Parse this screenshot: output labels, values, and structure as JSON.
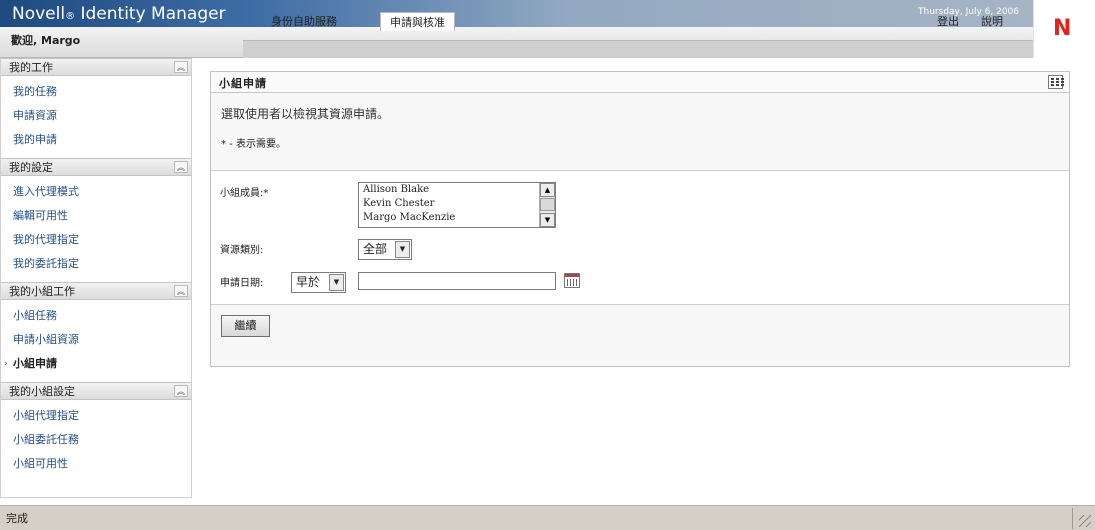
{
  "app": {
    "brand": "Novell",
    "brand_reg": "®",
    "brand_rest": " Identity Manager",
    "date": "Thursday, July 6, 2006",
    "logo_letter": "N"
  },
  "header": {
    "welcome": "歡迎, Margo",
    "tabs": [
      {
        "label": "身份自助服務",
        "active": false
      },
      {
        "label": "申請與核准",
        "active": true
      }
    ],
    "logout": "登出",
    "help": "說明"
  },
  "sidebar": {
    "sections": [
      {
        "title": "我的工作",
        "items": [
          "我的任務",
          "申請資源",
          "我的申請"
        ]
      },
      {
        "title": "我的設定",
        "items": [
          "進入代理模式",
          "編輯可用性",
          "我的代理指定",
          "我的委託指定"
        ]
      },
      {
        "title": "我的小組工作",
        "items": [
          "小組任務",
          "申請小組資源",
          "小組申請"
        ],
        "current": "小組申請"
      },
      {
        "title": "我的小組設定",
        "items": [
          "小組代理指定",
          "小組委託任務",
          "小組可用性"
        ]
      }
    ],
    "collapse_glyph": "︽"
  },
  "main": {
    "title": "小組申請",
    "instruction": "選取使用者以檢視其資源申請。",
    "required_note": "* - 表示需要。",
    "form": {
      "members_label": "小組成員:*",
      "members": [
        "Allison Blake",
        "Kevin Chester",
        "Margo MacKenzie"
      ],
      "type_label": "資源類別:",
      "type_value": "全部",
      "date_label": "申請日期:",
      "date_operator": "早於",
      "date_value": ""
    },
    "continue_label": "繼續"
  },
  "status": {
    "text": "完成"
  },
  "colors": {
    "banner_start": "#1d4a7f",
    "link": "#24508c",
    "logo_red": "#e2231a"
  }
}
